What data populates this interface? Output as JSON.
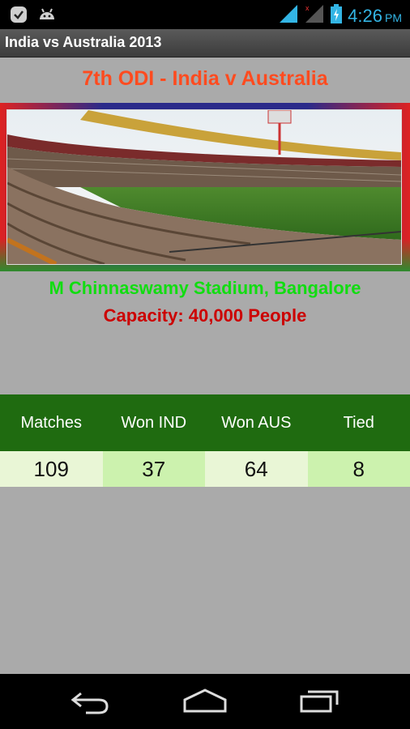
{
  "status_bar": {
    "time": "4:26",
    "ampm": "PM"
  },
  "app": {
    "title": "India vs Australia 2013"
  },
  "match": {
    "title": "7th ODI - India v Australia",
    "venue": "M Chinnaswamy Stadium, Bangalore",
    "capacity": "Capacity: 40,000 People"
  },
  "stats": {
    "headers": [
      "Matches",
      "Won IND",
      "Won AUS",
      "Tied"
    ],
    "values": [
      "109",
      "37",
      "64",
      "8"
    ]
  },
  "colors": {
    "title": "#ff4b1f",
    "venue": "#11dd11",
    "capacity": "#cc0000",
    "table_header": "#1f6b10",
    "clock": "#33b5e5"
  }
}
